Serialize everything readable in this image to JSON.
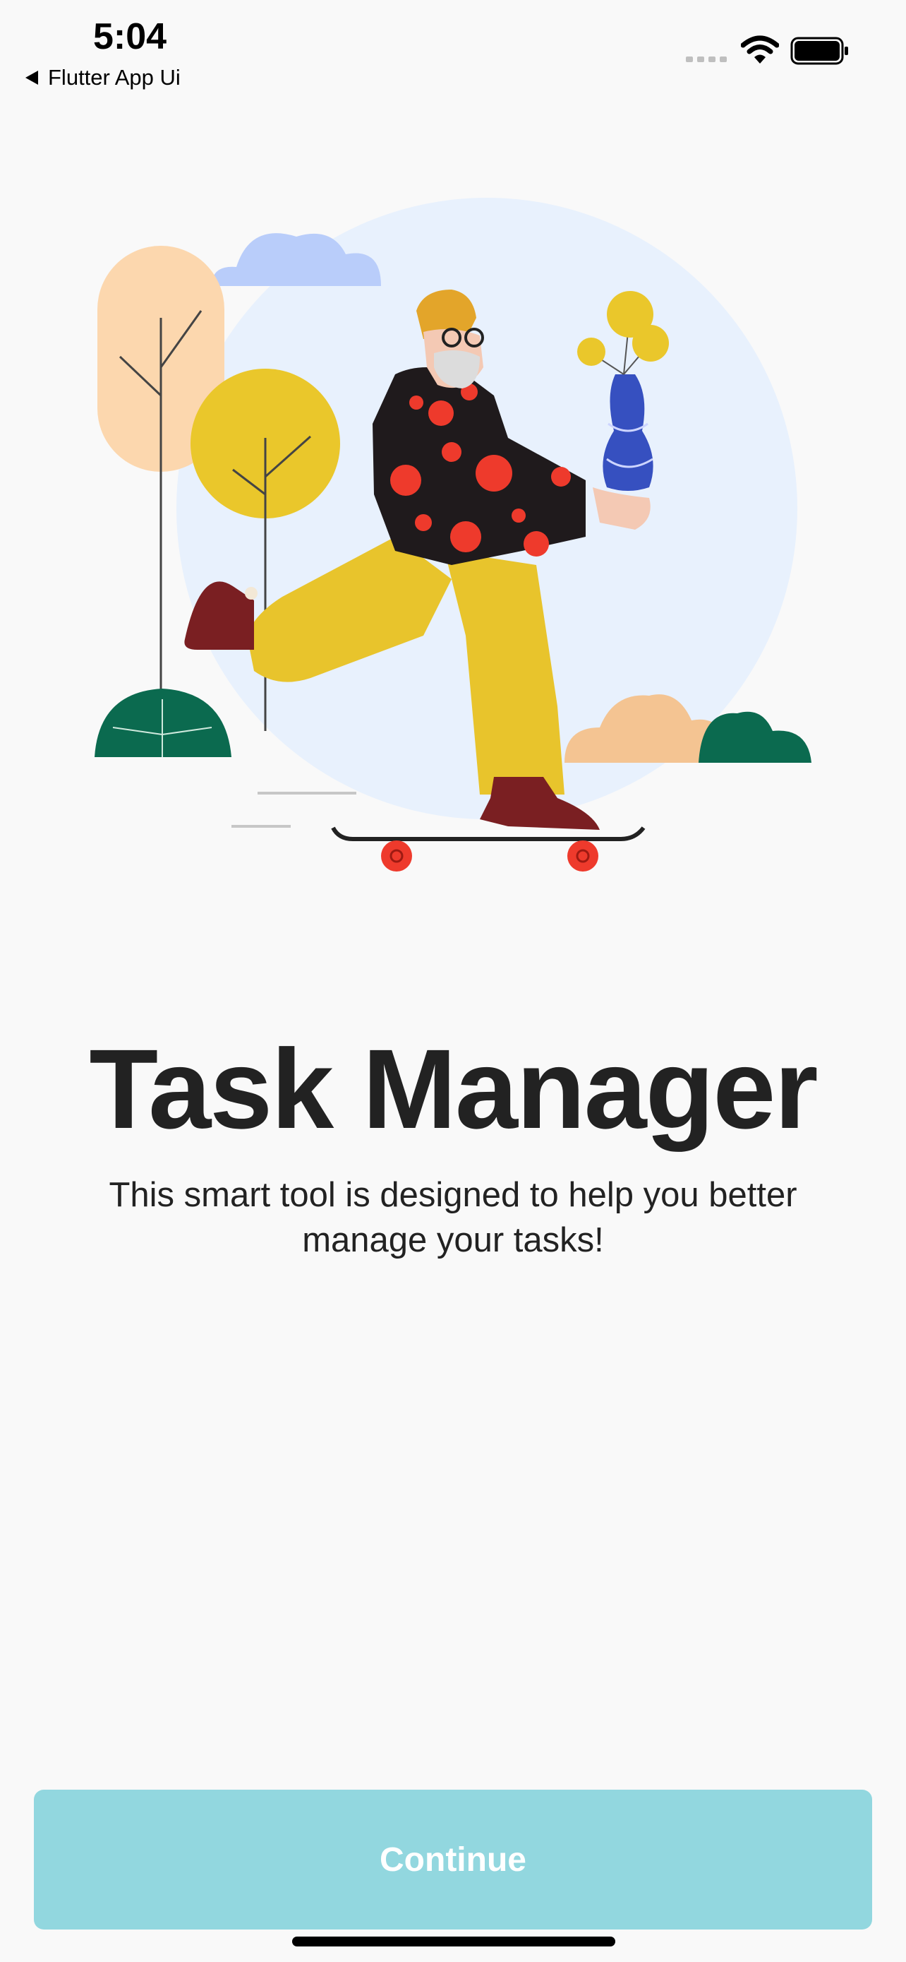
{
  "status_bar": {
    "time": "5:04",
    "back_app_label": "Flutter App Ui",
    "icons": [
      "signal-icon",
      "wifi-icon",
      "battery-icon"
    ]
  },
  "onboarding": {
    "illustration": "skateboarding-man-with-vase-illustration",
    "title": "Task Manager",
    "subtitle": "This smart tool is designed to help you better manage your tasks!",
    "continue_label": "Continue"
  },
  "colors": {
    "background": "#f9f9f9",
    "button": "#92d7df",
    "button_text": "#ffffff",
    "title_text": "#222222"
  }
}
